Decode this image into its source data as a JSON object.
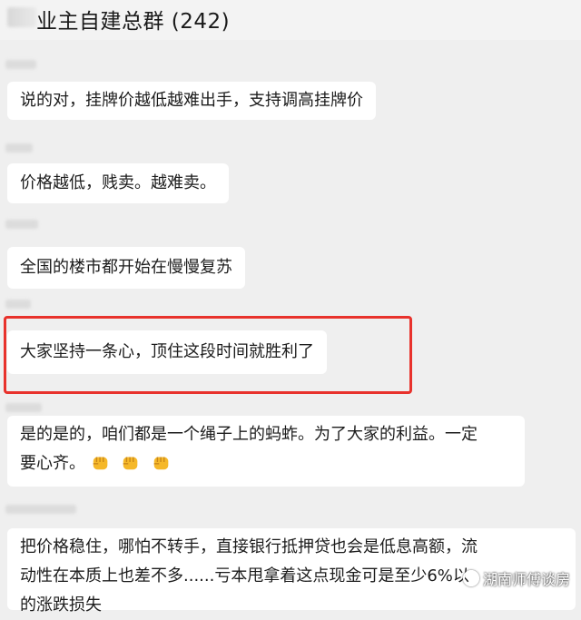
{
  "header": {
    "title": "业主自建总群 (242)"
  },
  "messages": [
    {
      "text": "说的对，挂牌价越低越难出手，支持调高挂牌价"
    },
    {
      "text": "价格越低，贱卖。越难卖。"
    },
    {
      "text": "全国的楼市都开始在慢慢复苏"
    },
    {
      "text": "大家坚持一条心，顶住这段时间就胜利了"
    },
    {
      "line1": "是的是的，咱们都是一个绳子上的蚂蚱。为了大家的利益。一定",
      "line2": "要心齐。",
      "emoji": "fist-emoji"
    },
    {
      "line1": "把价格稳住，哪怕不转手，直接银行抵押贷也会是低息高额，流",
      "line2": "动性在本质上也差不多......亏本甩拿着这点现金可是至少6%以",
      "line3": "的涨跌损失"
    }
  ],
  "watermark": {
    "text": "湖南师傅谈房"
  },
  "colors": {
    "highlight": "#e8322c",
    "bubble": "#ffffff",
    "background": "#efefef"
  }
}
